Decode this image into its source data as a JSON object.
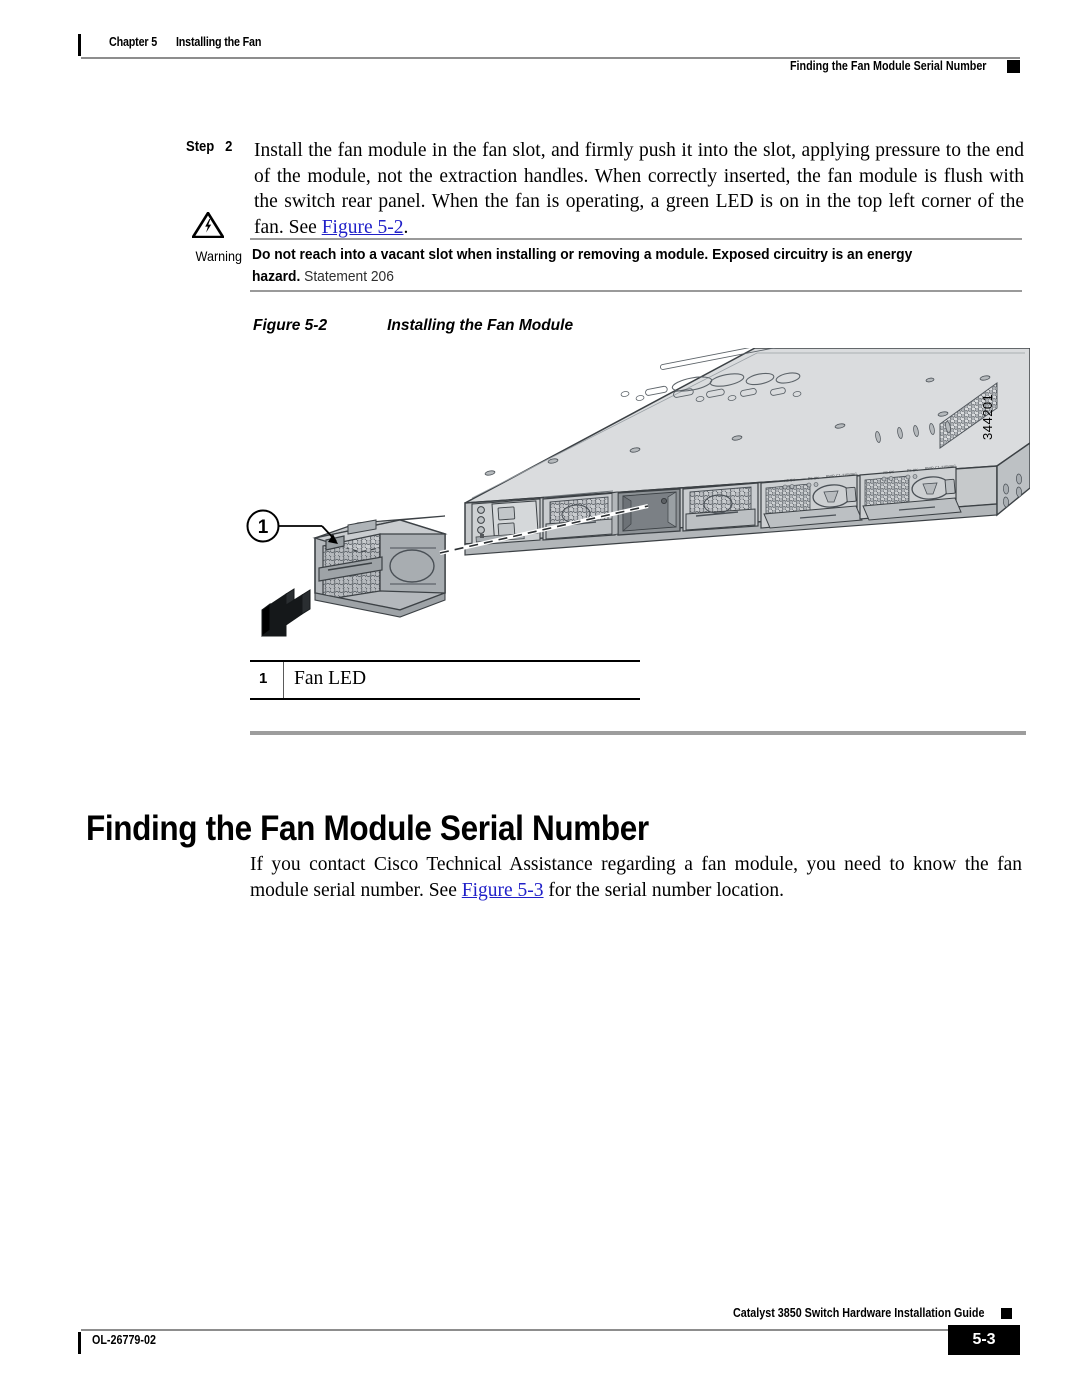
{
  "header": {
    "chapter_label": "Chapter 5",
    "chapter_title": "Installing the Fan",
    "running_head_right": "Finding the Fan Module Serial Number"
  },
  "step": {
    "label": "Step",
    "number": "2",
    "text_part1": "Install the fan module in the fan slot, and firmly push it into the slot, applying pressure to the end of the module, not the extraction handles. When correctly inserted, the fan module is flush with the switch rear panel. When the fan is operating, a green LED is on in the top left corner of the fan. See ",
    "xref": "Figure 5-2",
    "text_part2": "."
  },
  "warning": {
    "icon_name": "warning-triangle-lightning-icon",
    "label": "Warning",
    "bold_text": "Do not reach into a vacant slot when installing or removing a module. Exposed circuitry is an energy hazard.",
    "statement": " Statement 206"
  },
  "figure": {
    "caption_label": "Figure 5-2",
    "caption_title": "Installing the Fan Module",
    "figure_id": "344201",
    "callout_number": "1",
    "legend": {
      "number": "1",
      "text": "Fan LED"
    }
  },
  "section": {
    "heading": "Finding the Fan Module Serial Number",
    "paragraph_part1": "If you contact Cisco Technical Assistance regarding a fan module, you need to know the fan module serial number. See ",
    "paragraph_xref": "Figure 5-3",
    "paragraph_part2": " for the serial number location."
  },
  "footer": {
    "doc_number": "OL-26779-02",
    "guide_title": "Catalyst 3850 Switch Hardware Installation Guide",
    "page_number": "5-3"
  },
  "colors": {
    "xref_link": "#2020c8",
    "rule_gray": "#9a9a9a",
    "divider_gray": "#9d9d9d",
    "chassis_fill": "#d7d9da",
    "chassis_stroke": "#3c4145"
  }
}
